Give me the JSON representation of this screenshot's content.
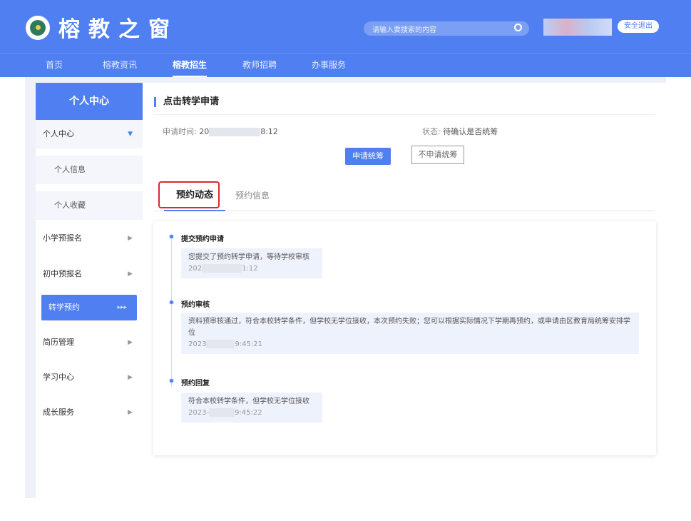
{
  "header": {
    "site_title": "榕教之窗",
    "search_placeholder": "请输入要搜索的内容",
    "logout_label": "安全退出"
  },
  "nav": {
    "items": [
      "首页",
      "榕教资讯",
      "榕教招生",
      "教师招聘",
      "办事服务"
    ],
    "active_index": 2
  },
  "sidebar": {
    "header": "个人中心",
    "items": [
      {
        "label": "个人中心",
        "type": "group"
      },
      {
        "label": "个人信息",
        "type": "sub"
      },
      {
        "label": "个人收藏",
        "type": "sub"
      },
      {
        "label": "小学预报名",
        "type": "item"
      },
      {
        "label": "初中预报名",
        "type": "item"
      },
      {
        "label": "转学预约",
        "type": "active"
      },
      {
        "label": "简历管理",
        "type": "item"
      },
      {
        "label": "学习中心",
        "type": "item"
      },
      {
        "label": "成长服务",
        "type": "item"
      }
    ]
  },
  "main": {
    "page_title": "点击转学申请",
    "apply_time_label": "申请时间:",
    "apply_time_prefix": "20",
    "apply_time_suffix": "8:12",
    "status_label": "状态:",
    "status_value": "待确认是否统筹",
    "btn_apply": "申请统筹",
    "btn_no_apply": "不申请统筹",
    "tabs": [
      "预约动态",
      "预约信息"
    ],
    "timeline": [
      {
        "title": "提交预约申请",
        "text": "您提交了预约转学申请，等待学校审核",
        "date_prefix": "202",
        "date_suffix": "1:12"
      },
      {
        "title": "预约审核",
        "text": "资料预审核通过，符合本校转学条件，但学校无学位接收，本次预约失败；您可以根据实际情况下学期再预约，或申请由区教育局统筹安排学位",
        "date_prefix": "2023",
        "date_suffix": "9:45:21"
      },
      {
        "title": "预约回复",
        "text": "符合本校转学条件，但学校无学位接收",
        "date_prefix": "2023-",
        "date_suffix": "9:45:22"
      }
    ]
  }
}
